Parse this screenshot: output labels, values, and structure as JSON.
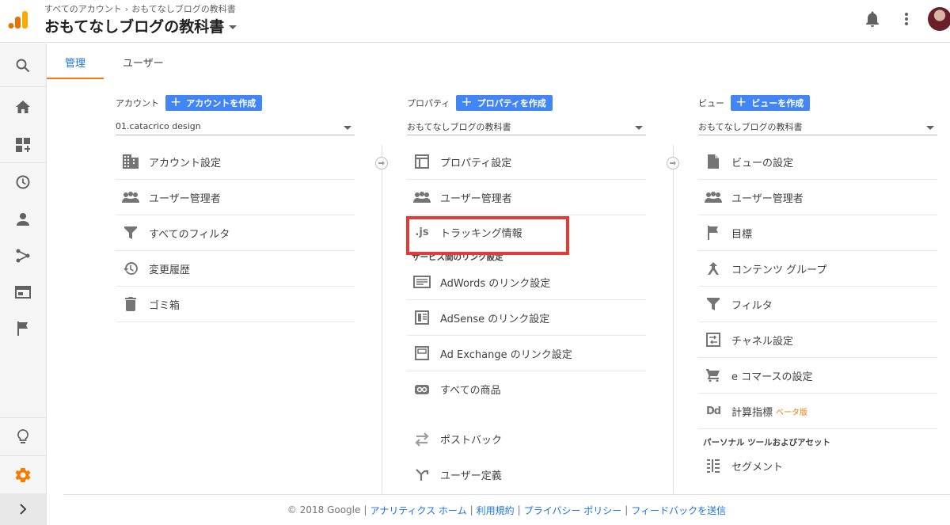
{
  "header": {
    "breadcrumb_root": "すべてのアカウント",
    "breadcrumb_sep": "›",
    "breadcrumb_current": "おもてなしブログの教科書",
    "property_title": "おもてなしブログの教科書"
  },
  "tabs": {
    "admin": "管理",
    "user": "ユーザー"
  },
  "account": {
    "label": "アカウント",
    "create": "アカウントを作成",
    "selected": "01.catacrico design",
    "items": [
      "アカウント設定",
      "ユーザー管理者",
      "すべてのフィルタ",
      "変更履歴",
      "ゴミ箱"
    ]
  },
  "property": {
    "label": "プロパティ",
    "create": "プロパティを作成",
    "selected": "おもてなしブログの教科書",
    "items": [
      "プロパティ設定",
      "ユーザー管理者",
      "トラッキング情報"
    ],
    "js_glyph": ".js",
    "section_title": "サービス間のリンク設定",
    "link_items": [
      "AdWords のリンク設定",
      "AdSense のリンク設定",
      "Ad Exchange のリンク設定",
      "すべての商品"
    ],
    "extra_items": [
      "ポストバック",
      "ユーザー定義"
    ]
  },
  "view": {
    "label": "ビュー",
    "create": "ビューを作成",
    "selected": "おもてなしブログの教科書",
    "items": [
      "ビューの設定",
      "ユーザー管理者",
      "目標",
      "コンテンツ グループ",
      "フィルタ",
      "チャネル設定",
      "e コマースの設定",
      "計算指標"
    ],
    "beta": "ベータ版",
    "dd_glyph": "Dd",
    "section_title": "パーソナル ツールおよびアセット",
    "personal_items": [
      "セグメント"
    ]
  },
  "footer": {
    "copyright": "© 2018 Google",
    "links": [
      "アナリティクス ホーム",
      "利用規約",
      "プライバシー ポリシー",
      "フィードバックを送信"
    ]
  },
  "colors": {
    "accent": "#4285f4",
    "tab_indicator": "#f57c00",
    "highlight": "#e53935",
    "logo_orange": "#f9ab00",
    "logo_dark": "#e37400"
  },
  "icons": {
    "header": [
      "analytics-logo-icon",
      "bell-icon",
      "more-vert-icon"
    ],
    "nav": [
      "search-icon",
      "home-icon",
      "customization-icon",
      "realtime-clock-icon",
      "audience-person-icon",
      "acquisition-icon",
      "behavior-icon",
      "conversions-flag-icon",
      "discover-lightbulb-icon",
      "admin-gear-icon",
      "expand-chevron-icon"
    ]
  }
}
